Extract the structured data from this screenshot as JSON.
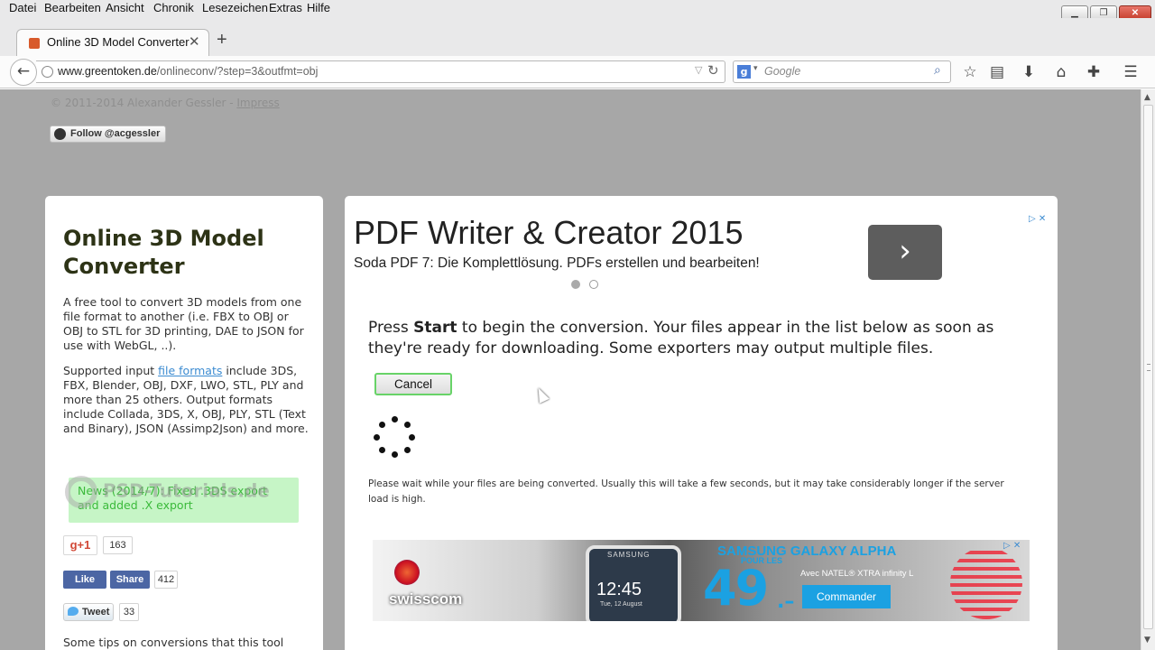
{
  "menu": [
    "Datei",
    "Bearbeiten",
    "Ansicht",
    "Chronik",
    "Lesezeichen",
    "Extras",
    "Hilfe"
  ],
  "window_controls": {
    "minimize": "▁",
    "maximize": "❐",
    "close": "✕"
  },
  "tab": {
    "title": "Online 3D Model Converter",
    "close": "✕",
    "new_tab": "+"
  },
  "navbar": {
    "back": "←",
    "url_domain": "www.greentoken.de",
    "url_path": "/onlineconv/?step=3&outfmt=obj",
    "url_prefix": "",
    "dropdown": "▽",
    "reload": "↻",
    "search_placeholder": "Google",
    "search_engine": "g",
    "search_arrow": "▾",
    "search_icon": "⌕",
    "toolbar_icons": [
      "☆",
      "▤",
      "⬇",
      "⌂",
      "✚",
      "☰"
    ]
  },
  "page": {
    "copyright": "© 2011-2014 Alexander Gessler - ",
    "impress": "Impress",
    "follow": "Follow @acgessler",
    "left": {
      "title": "Online 3D Model Converter",
      "intro": "A free tool to convert 3D models from one file format to another (i.e. FBX to OBJ or OBJ to STL for 3D printing, DAE to JSON for use with WebGL, ..).",
      "supported_pre": "Supported input ",
      "supported_link": "file formats",
      "supported_post": " include 3DS, FBX, Blender, OBJ, DXF, LWO, STL, PLY and more than 25 others. Output formats include Collada, 3DS, X, OBJ, PLY, STL (Text and Binary), JSON (Assimp2Json) and more.",
      "news": "News (2014/7): Fixed .3DS export and added .X export",
      "gplus_label": "g+1",
      "gplus_count": "163",
      "fb_like": "Like",
      "fb_share": "Share",
      "fb_count": "412",
      "tweet_label": "Tweet",
      "tweet_count": "33",
      "watermark": "PSD-Tutorials.de",
      "tips": "Some tips on conversions that this tool"
    },
    "right": {
      "ad_headline": "PDF Writer & Creator 2015",
      "ad_sub": "Soda PDF 7: Die Komplettlösung. PDFs erstellen und bearbeiten!",
      "ad_go": "›",
      "ad_choices": "▷ ✕",
      "prompt_pre": "Press ",
      "prompt_bold": "Start",
      "prompt_post": " to begin the conversion. Your files appear in the list below as soon as they're ready for downloading. Some exporters may output multiple files.",
      "cancel": "Cancel",
      "wait": "Please wait while your files are being converted. Usually this will take a few seconds, but it may take considerably longer if the server load is high.",
      "banner": {
        "brand": "swisscom",
        "phone_brand": "SAMSUNG",
        "clock": "12:45",
        "date": "Tue, 12 August",
        "headline": "SAMSUNG GALAXY ALPHA",
        "pour": "POUR LES",
        "price": "49",
        "price_tail": ".–",
        "natel": "Avec NATEL® XTRA infinity L",
        "cta": "Commander"
      }
    }
  },
  "colors": {
    "accent_green": "#68d368",
    "news_bg": "#c6f5c6",
    "link": "#3b8bd1",
    "banner_blue": "#1ba1e2"
  }
}
